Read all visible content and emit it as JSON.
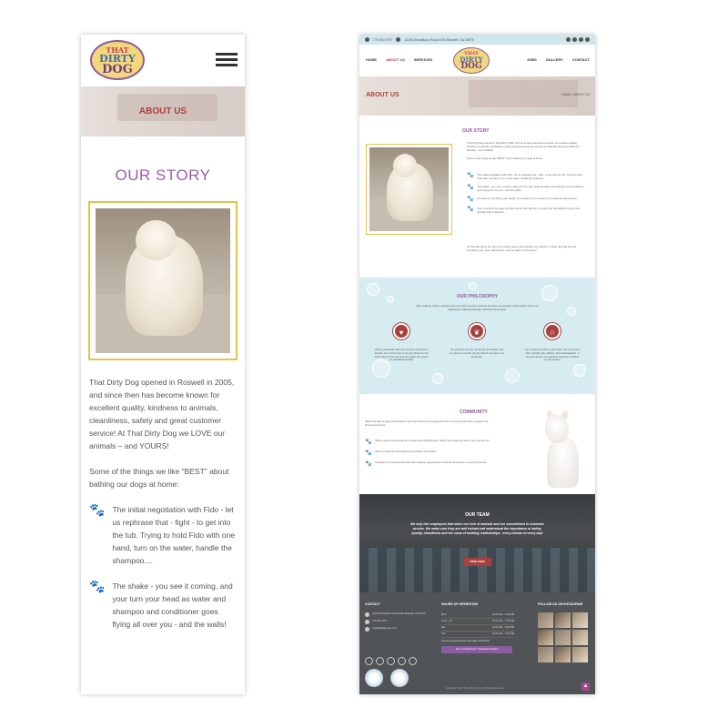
{
  "brand": {
    "logo_line1": "THAT",
    "logo_line2": "DIRTY",
    "logo_line3": "DOG"
  },
  "mobile": {
    "banner_title": "ABOUT US",
    "story_title": "OUR STORY",
    "intro_p1": "That Dirty Dog opened in Roswell in 2005, and since then has become known for excellent quality, kindness to animals, cleanliness, safety and great customer service!  At That Dirty Dog we LOVE our animals – and YOURS!",
    "intro_p2": "Some of the things we like \"BEST\" about bathing our dogs at home:",
    "items": [
      "The initial negotiation with Fido - let us rephrase that - fight - to get into the tub. Trying to hold Fido with one hand, turn on the water, handle the shampoo....",
      "The shake - you see it coming, and your turn your head as water and shampoo and conditioner goes flying all over you - and the walls!"
    ]
  },
  "desktop": {
    "topbar": {
      "phone": "770.993.7977",
      "address": "11155 Woodstock Road #190 Roswell, GA 30075"
    },
    "nav_left": [
      "HOME",
      "ABOUT US",
      "SERVICES"
    ],
    "nav_right": [
      "JOBS",
      "GALLERY",
      "CONTACT"
    ],
    "banner_title": "ABOUT US",
    "breadcrumb": "HOME / ABOUT US",
    "story": {
      "title": "OUR STORY",
      "p1": "That Dirty Dog opened in Roswell in 2005, and since then has become known for excellent quality, kindness to animals, cleanliness, safety and great customer service! At That Dirty Dog we LOVE our animals – and YOURS!",
      "p2": "Some of the things we like \"BEST\" about bathing our dogs at home:",
      "items": [
        "The initial negotiation with Fido - let us rephrase that - fight - to get into the tub. Trying to hold Fido with one hand, turn on the water, handle the shampoo....",
        "The shake - you see it coming, and your turn your head as water and shampoo and conditioner goes flying all over you - and the walls!",
        "It's hard on your back, your hands, your knees not to mention your patience and temper!",
        "And, of course the clean up! Wet towels, hair still wet, a messy tub, the bathroom floor, and another load of laundry!"
      ],
      "closing": "At That Dirty Dog, we offer you a better way to accomplish your mission: a clean dog! We provide everything you need, within reach, and we clean up the mess!"
    },
    "philosophy": {
      "title": "OUR PHILOSOPHY",
      "intro": "After realizing what a valuable and convenient service could be provided, we thought a little deeper about our philosophy regarding animals, business and people:",
      "cols": [
        {
          "icon": "♥",
          "text": "We are passionate about the humane treatment of animals. Our environment is not only about fun, but about safety for the pets and the people who groom our establishment daily."
        },
        {
          "icon": "❦",
          "text": "Our products are safe, all-natural, and healthy, and our goal is to provide only the best for the pets in our community."
        },
        {
          "icon": "☆",
          "text": "Our customer service is, paws down, the very best in town. Friendly, fast, efficient, and knowledgeable - if we can't answer your question ourselves, we'll find you an answer!"
        }
      ]
    },
    "community": {
      "title": "COMMUNITY",
      "intro": "What's the point of going into business if you can't become an integral part of the community? We strive to support our local community by:",
      "items": [
        "Being a great business partner to other local establishments, helping and supporting them in any way we can.",
        "Being an advocate and supporting fundraisers for charities.",
        "Donating to community clubs that offer volunteer opportunities to help the community on a variety of levels."
      ]
    },
    "team": {
      "title": "OUR TEAM",
      "text": "We only hire employees that share our love of animals and our commitment to customer service. We make sure they are well trained and understand the importance of safety, quality, cleanliness and the value of building relationships - every minute of every day!",
      "button": "VIEW JOBS"
    },
    "footer": {
      "contact_title": "CONTACT",
      "contact_rows": [
        "11155 Woodstock Road #190 Roswell, GA 30075",
        "770.993.7977",
        "info@thatdirtydog.com"
      ],
      "hours_title": "HOURS OF OPERATION",
      "hours": [
        {
          "day": "Mon",
          "time": "10:00 AM – 6:00 PM"
        },
        {
          "day": "Tues – Fri",
          "time": "10:00 AM – 7:00 PM"
        },
        {
          "day": "Sat",
          "time": "10:00 AM – 6:00 PM"
        },
        {
          "day": "Sun",
          "time": "11:00 AM – 5:00 PM"
        }
      ],
      "hours_note": "Grooming appointments start daily at 8:30 AM",
      "rewards_button": "Join our Freshness™ Rewards Program!",
      "instagram_title": "FOLLOW US ON INSTAGRAM",
      "copyright": "Copyright © 2017 That Dirty Dog Inc. All Rights Reserved.",
      "top_icon": "▲"
    }
  }
}
